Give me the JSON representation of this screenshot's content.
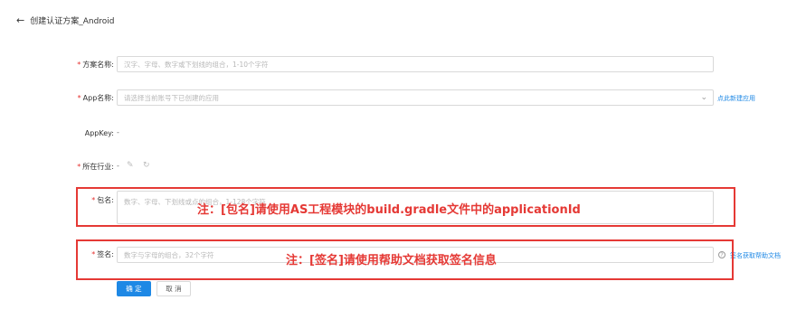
{
  "header": {
    "title": "创建认证方案_Android",
    "back_icon": "arrow-left-icon"
  },
  "form": {
    "scheme_name": {
      "required": "*",
      "label": "方案名称:",
      "placeholder": "汉字、字母、数字或下划线的组合，1-10个字符"
    },
    "app_name": {
      "required": "*",
      "label": "App名称:",
      "placeholder": "请选择当前账号下已创建的应用",
      "link": "点此新建应用"
    },
    "appkey": {
      "label": "AppKey:",
      "value": "-"
    },
    "industry": {
      "required": "*",
      "label": "所在行业:",
      "value": "-"
    },
    "package_name": {
      "required": "*",
      "label": "包名:",
      "placeholder": "数字、字母、下划线或点的组合，1-128个字符"
    },
    "signature": {
      "required": "*",
      "label": "签名:",
      "placeholder": "数字与字母的组合，32个字符",
      "help_link": "签名获取帮助文档",
      "help_icon_text": "?"
    }
  },
  "annotations": {
    "package": "注：[包名]请使用AS工程模块的build.gradle文件中的applicationId",
    "signature": "注：[签名]请使用帮助文档获取签名信息"
  },
  "buttons": {
    "confirm": "确 定",
    "cancel": "取 消"
  },
  "colors": {
    "accent": "#1e88e5",
    "required": "#e5302e",
    "annotation": "#e53935"
  }
}
